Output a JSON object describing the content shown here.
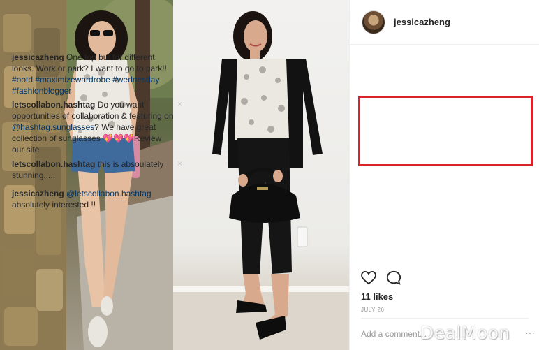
{
  "header": {
    "username": "jessicazheng",
    "avatar_icon": "profile-avatar"
  },
  "caption": {
    "user": "jessicazheng",
    "text": " One top but for different looks. Work or park? I want to go to park!! ",
    "hashtags": [
      "#ootd",
      "#maximizewardrobe",
      "#wednesday",
      "#fashionblogger"
    ]
  },
  "comments": [
    {
      "user": "letscollabon.hashtag",
      "text_before": " Do you want opportunities of collaboration & featuring on ",
      "mention": "@hashtag.sunglasses",
      "text_after": "? We have great collection of sunglasses 💖💖💖Review our site",
      "delete_icon": "×"
    },
    {
      "user": "letscollabon.hashtag",
      "text": " this is absoulately stunning.....",
      "delete_icon": "×"
    },
    {
      "user": "jessicazheng",
      "mention": "@letscollabon.hashtag",
      "text": " absolutely interested !!"
    }
  ],
  "actions": {
    "like_icon": "heart-outline-icon",
    "comment_icon": "comment-bubble-icon"
  },
  "likes": "11 likes",
  "date": "JULY 26",
  "add_comment_placeholder": "Add a comment...",
  "more_label": "···",
  "watermark": "DealMoon",
  "colors": {
    "link": "#003569",
    "highlight": "#d8232a",
    "muted": "#999999"
  }
}
